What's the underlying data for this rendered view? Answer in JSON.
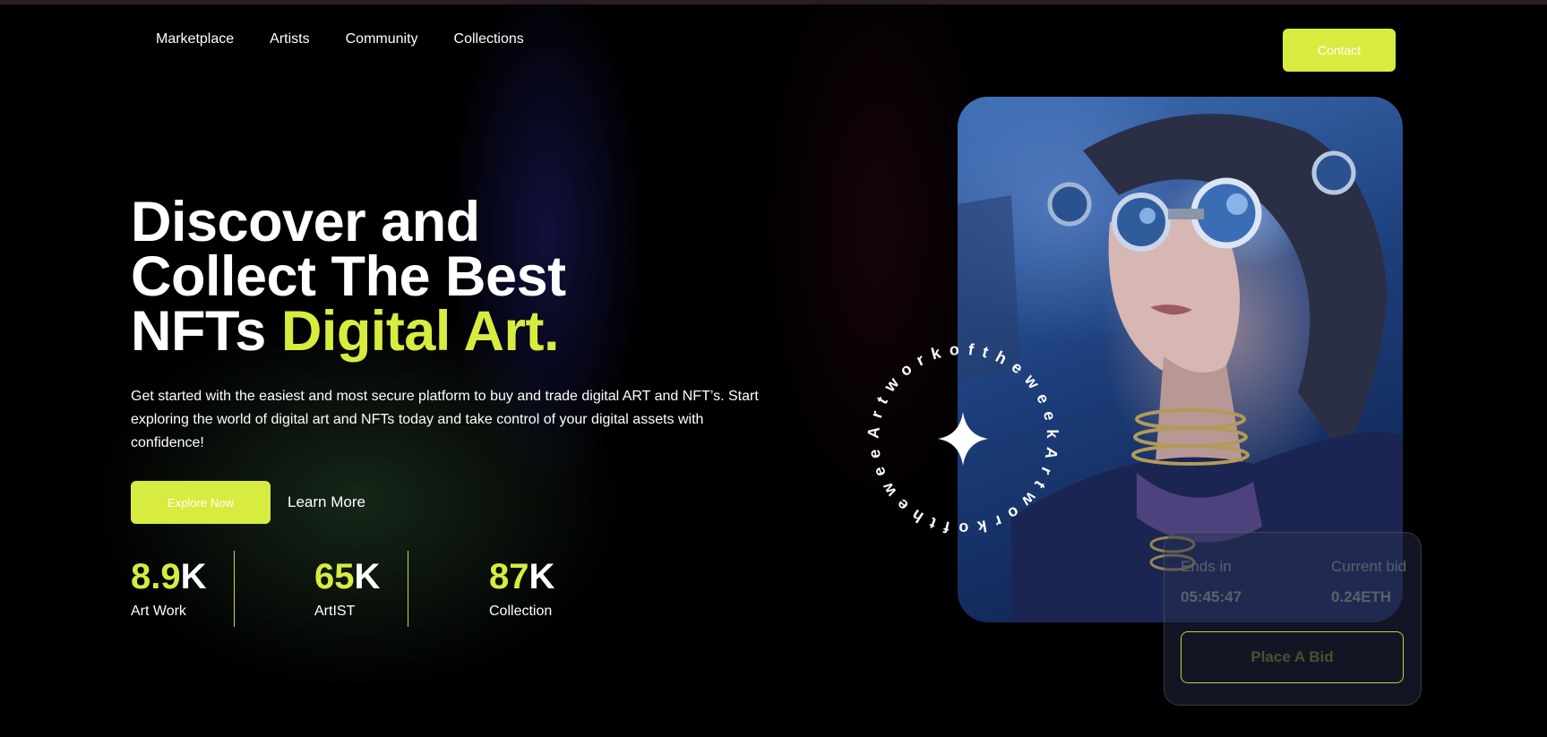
{
  "nav": {
    "items": [
      {
        "label": "Marketplace"
      },
      {
        "label": "Artists"
      },
      {
        "label": "Community"
      },
      {
        "label": "Collections"
      }
    ],
    "contact_label": "Contact"
  },
  "hero": {
    "headline_line1": "Discover and",
    "headline_line2": "Collect The Best",
    "headline_line3_plain": "NFTs ",
    "headline_line3_accent": "Digital Art.",
    "description": "Get started with the easiest and most secure platform to buy and trade digital ART and NFT’s. Start exploring the world of digital art and NFTs today and take control of your digital assets with confidence!",
    "explore_label": "Explore Now",
    "learn_label": "Learn More"
  },
  "stats": [
    {
      "value": "8.9",
      "suffix": "K",
      "label": "Art Work"
    },
    {
      "value": "65",
      "suffix": "K",
      "label": "ArtIST"
    },
    {
      "value": "87",
      "suffix": "K",
      "label": "Collection"
    }
  ],
  "artwork": {
    "ring_text": "Artworkoftheweek",
    "ends_in_label": "Ends in",
    "ends_in_value": "05:45:47",
    "current_bid_label": "Current bid",
    "current_bid_value": "0.24ETH",
    "bid_button_label": "Place A Bid",
    "star_icon": "four-point-star-icon"
  },
  "colors": {
    "accent": "#d8ec3f",
    "background": "#000000"
  }
}
